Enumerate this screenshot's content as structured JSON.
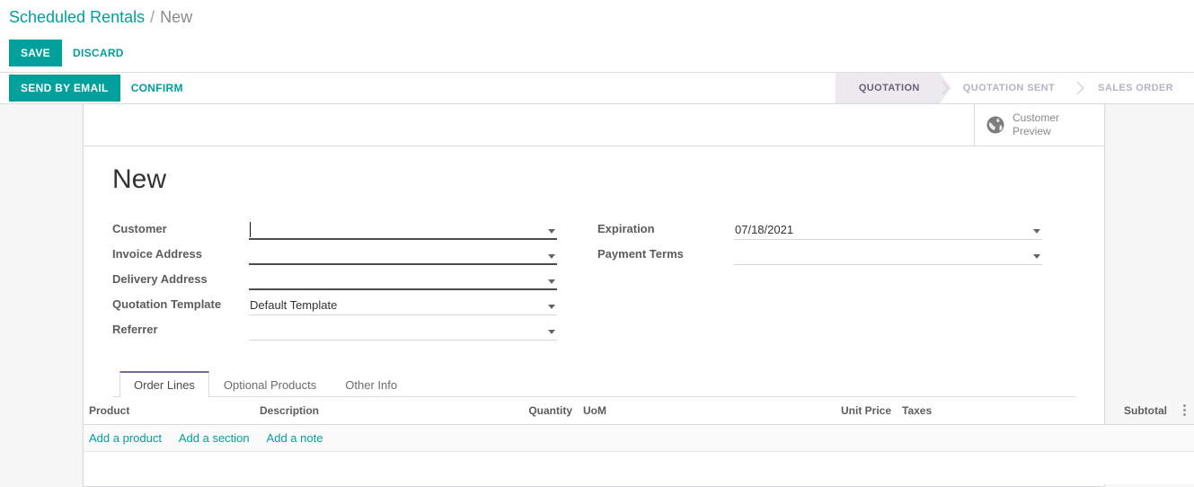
{
  "breadcrumb": {
    "root": "Scheduled Rentals",
    "separator": "/",
    "current": "New"
  },
  "action_bar": {
    "save_label": "SAVE",
    "discard_label": "DISCARD"
  },
  "status_bar": {
    "send_by_email_label": "SEND BY EMAIL",
    "confirm_label": "CONFIRM",
    "stages": [
      {
        "label": "QUOTATION",
        "active": true
      },
      {
        "label": "QUOTATION SENT",
        "active": false
      },
      {
        "label": "SALES ORDER",
        "active": false
      }
    ]
  },
  "button_box": {
    "customer_preview": {
      "icon": "globe-icon",
      "line1": "Customer",
      "line2": "Preview"
    }
  },
  "form": {
    "title": "New",
    "left_fields": [
      {
        "label": "Customer",
        "value": "",
        "required": true,
        "focused": true
      },
      {
        "label": "Invoice Address",
        "value": "",
        "required": true,
        "focused": false
      },
      {
        "label": "Delivery Address",
        "value": "",
        "required": true,
        "focused": false
      },
      {
        "label": "Quotation Template",
        "value": "Default Template",
        "required": false,
        "focused": false
      },
      {
        "label": "Referrer",
        "value": "",
        "required": false,
        "focused": false
      }
    ],
    "right_fields": [
      {
        "label": "Expiration",
        "value": "07/18/2021",
        "required": false,
        "focused": false
      },
      {
        "label": "Payment Terms",
        "value": "",
        "required": false,
        "focused": false
      }
    ]
  },
  "notebook": {
    "tabs": [
      {
        "label": "Order Lines",
        "active": true
      },
      {
        "label": "Optional Products",
        "active": false
      },
      {
        "label": "Other Info",
        "active": false
      }
    ]
  },
  "order_lines": {
    "columns": [
      "Product",
      "Description",
      "Quantity",
      "UoM",
      "Unit Price",
      "Taxes",
      "Subtotal"
    ],
    "optional_columns_icon": "vertical-dots-icon",
    "rows": [],
    "add_links": [
      "Add a product",
      "Add a section",
      "Add a note"
    ]
  },
  "colors": {
    "accent": "#00a09d",
    "stage_active_bg": "#eceaef",
    "stage_active_text": "#6b5f7a",
    "tab_active_border": "#7c6a94",
    "page_bg": "#f7f7f7"
  }
}
